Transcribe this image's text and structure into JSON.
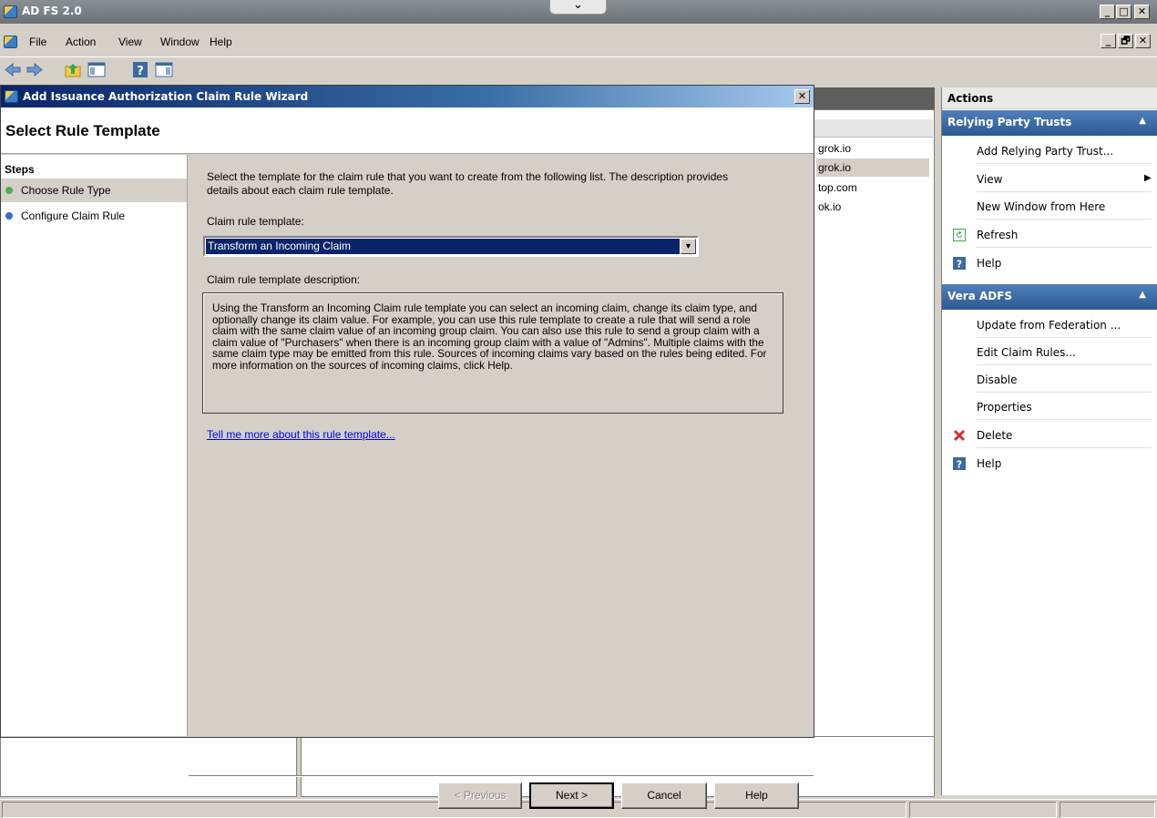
{
  "app": {
    "title": "AD FS 2.0",
    "min_label": "_",
    "max_label": "□",
    "close_label": "✕",
    "restore_label": "🗗"
  },
  "menu": [
    "File",
    "Action",
    "View",
    "Window",
    "Help"
  ],
  "center_list": {
    "rows": [
      "grok.io",
      "grok.io",
      "top.com",
      "ok.io"
    ]
  },
  "actions": {
    "title": "Actions",
    "sections": [
      {
        "title": "Relying Party Trusts",
        "items": [
          "Add Relying Party Trust...",
          "View",
          "New Window from Here",
          "Refresh",
          "Help"
        ]
      },
      {
        "title": "Vera ADFS",
        "items": [
          "Update from Federation ...",
          "Edit Claim Rules...",
          "Disable",
          "Properties",
          "Delete",
          "Help"
        ]
      }
    ]
  },
  "wizard": {
    "title": "Add Issuance Authorization Claim Rule Wizard",
    "heading": "Select Rule Template",
    "steps_title": "Steps",
    "steps": [
      {
        "label": "Choose Rule Type",
        "state": "current",
        "color": "#4caf50"
      },
      {
        "label": "Configure Claim Rule",
        "state": "pending",
        "color": "#2f6fd1"
      }
    ],
    "instruction": "Select the template for the claim rule that you want to create from the following list. The description provides details about each claim rule template.",
    "template_label": "Claim rule template:",
    "template_value": "Transform an Incoming Claim",
    "description_label": "Claim rule template description:",
    "description": "Using the Transform an Incoming Claim rule template you can select an incoming claim, change its claim type, and optionally change its claim value.  For example, you can use this rule template to create a rule that will send a role claim with the same claim value of an incoming group claim.  You can also use this rule to send a group claim with a claim value of \"Purchasers\" when there is an incoming group claim with a value of \"Admins\".  Multiple claims with the same claim type may be emitted from this rule.  Sources of incoming claims vary based on the rules being edited.  For more information on the sources of incoming claims, click Help.",
    "more_link": "Tell me more about this rule template...",
    "buttons": {
      "previous": "< Previous",
      "next": "Next >",
      "cancel": "Cancel",
      "help": "Help"
    },
    "close_label": "✕"
  },
  "colors": {
    "dialog_title_start": "#0a246a",
    "selection": "#0a246a",
    "actions_section": "#3a68a4",
    "link": "#0000ee"
  }
}
